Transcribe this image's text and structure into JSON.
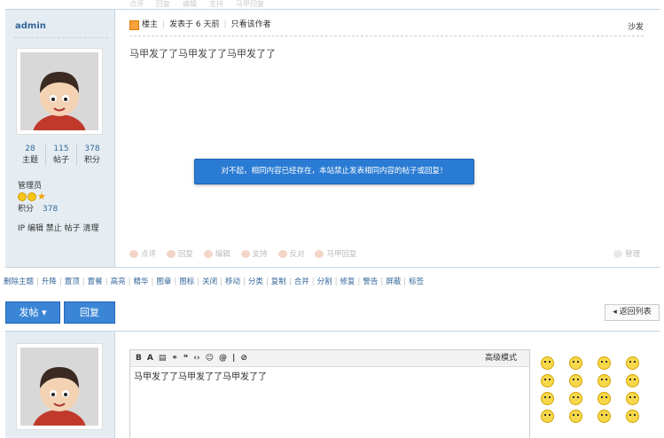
{
  "prev_post_actions": [
    "点评",
    "回复",
    "编辑",
    "支持",
    "马甲回复"
  ],
  "post": {
    "author": {
      "name": "admin",
      "stats": [
        {
          "num": "28",
          "label": "主题"
        },
        {
          "num": "115",
          "label": "帖子"
        },
        {
          "num": "378",
          "label": "积分"
        }
      ],
      "group": "管理员",
      "score_label": "积分",
      "score_value": "378",
      "admin_links": "IP 编辑 禁止 帖子 清理"
    },
    "header": {
      "owner_tag": "楼主",
      "posted": "发表于 6 天前",
      "only_author": "只看该作者",
      "floor": "沙发"
    },
    "content": "马甲发了了马甲发了了马甲发了了",
    "tooltip": "对不起，相同内容已经存在，本站禁止发表相同内容的帖子或回复！",
    "actions": [
      "点评",
      "回复",
      "编辑",
      "支持",
      "反对",
      "马甲回复"
    ],
    "manage": "管理"
  },
  "mod_links": [
    "删除主题",
    "升降",
    "置顶",
    "置餐",
    "高亮",
    "精华",
    "图章",
    "图标",
    "关闭",
    "移动",
    "分类",
    "复制",
    "合并",
    "分割",
    "修复",
    "警告",
    "屏蔽",
    "标签"
  ],
  "buttons": {
    "post": "发帖 ▾",
    "reply": "回复",
    "back": "◂ 返回列表"
  },
  "editor": {
    "toolbar": [
      "B",
      "A",
      "▤",
      "⚭",
      "❝",
      "‹›",
      "☺",
      "@",
      "|",
      "⊘"
    ],
    "advanced": "高级模式",
    "text": "马甲发了了马甲发了了马甲发了了"
  },
  "smilies": [
    "smile",
    "sad",
    "biggrin",
    "cry",
    "huffy",
    "shocked",
    "tongue",
    "shy",
    "titter",
    "sweat",
    "mad",
    "lol",
    "loveliness",
    "funk",
    "curse",
    "dizzy"
  ]
}
